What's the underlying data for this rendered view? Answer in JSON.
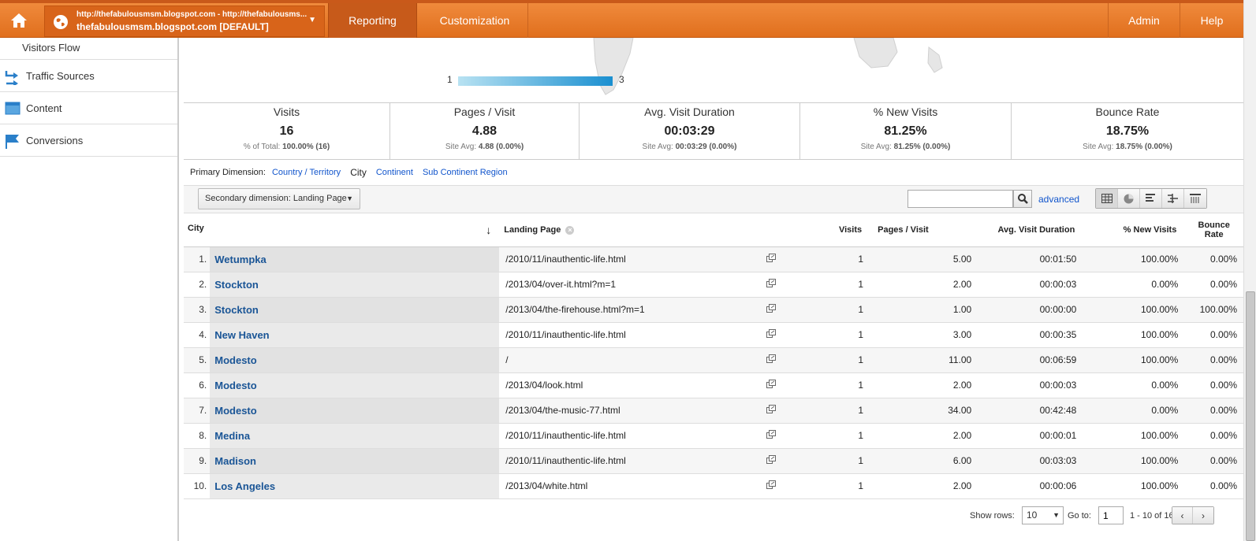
{
  "topbar": {
    "account_line1": "http://thefabulousmsm.blogspot.com - http://thefabulousms...",
    "account_line2": "thefabulousmsm.blogspot.com [DEFAULT]",
    "tabs": [
      "Reporting",
      "Customization"
    ],
    "right_tabs": [
      "Admin",
      "Help"
    ]
  },
  "sidebar": {
    "items": [
      "Visitors Flow",
      "Traffic Sources",
      "Content",
      "Conversions"
    ]
  },
  "legend": {
    "low": "1",
    "high": "3"
  },
  "summary": [
    {
      "title": "Visits",
      "value": "16",
      "sub_label": "% of Total:",
      "sub_value": "100.00% (16)"
    },
    {
      "title": "Pages / Visit",
      "value": "4.88",
      "sub_label": "Site Avg:",
      "sub_value": "4.88 (0.00%)"
    },
    {
      "title": "Avg. Visit Duration",
      "value": "00:03:29",
      "sub_label": "Site Avg:",
      "sub_value": "00:03:29 (0.00%)"
    },
    {
      "title": "% New Visits",
      "value": "81.25%",
      "sub_label": "Site Avg:",
      "sub_value": "81.25% (0.00%)"
    },
    {
      "title": "Bounce Rate",
      "value": "18.75%",
      "sub_label": "Site Avg:",
      "sub_value": "18.75% (0.00%)"
    }
  ],
  "dimensions": {
    "label": "Primary Dimension:",
    "options": [
      "Country / Territory",
      "City",
      "Continent",
      "Sub Continent Region"
    ],
    "selected": "City"
  },
  "toolbar": {
    "secondary_dimension": "Secondary dimension: Landing Page",
    "search_value": "",
    "advanced": "advanced"
  },
  "table": {
    "headers": [
      "City",
      "Landing Page",
      "Visits",
      "Pages / Visit",
      "Avg. Visit Duration",
      "% New Visits",
      "Bounce Rate"
    ],
    "rows": [
      {
        "idx": "1.",
        "city": "Wetumpka",
        "page": "/2010/11/inauthentic-life.html",
        "visits": "1",
        "ppv": "5.00",
        "dur": "00:01:50",
        "newv": "100.00%",
        "bounce": "0.00%"
      },
      {
        "idx": "2.",
        "city": "Stockton",
        "page": "/2013/04/over-it.html?m=1",
        "visits": "1",
        "ppv": "2.00",
        "dur": "00:00:03",
        "newv": "0.00%",
        "bounce": "0.00%"
      },
      {
        "idx": "3.",
        "city": "Stockton",
        "page": "/2013/04/the-firehouse.html?m=1",
        "visits": "1",
        "ppv": "1.00",
        "dur": "00:00:00",
        "newv": "100.00%",
        "bounce": "100.00%"
      },
      {
        "idx": "4.",
        "city": "New Haven",
        "page": "/2010/11/inauthentic-life.html",
        "visits": "1",
        "ppv": "3.00",
        "dur": "00:00:35",
        "newv": "100.00%",
        "bounce": "0.00%"
      },
      {
        "idx": "5.",
        "city": "Modesto",
        "page": "/",
        "visits": "1",
        "ppv": "11.00",
        "dur": "00:06:59",
        "newv": "100.00%",
        "bounce": "0.00%"
      },
      {
        "idx": "6.",
        "city": "Modesto",
        "page": "/2013/04/look.html",
        "visits": "1",
        "ppv": "2.00",
        "dur": "00:00:03",
        "newv": "0.00%",
        "bounce": "0.00%"
      },
      {
        "idx": "7.",
        "city": "Modesto",
        "page": "/2013/04/the-music-77.html",
        "visits": "1",
        "ppv": "34.00",
        "dur": "00:42:48",
        "newv": "0.00%",
        "bounce": "0.00%"
      },
      {
        "idx": "8.",
        "city": "Medina",
        "page": "/2010/11/inauthentic-life.html",
        "visits": "1",
        "ppv": "2.00",
        "dur": "00:00:01",
        "newv": "100.00%",
        "bounce": "0.00%"
      },
      {
        "idx": "9.",
        "city": "Madison",
        "page": "/2010/11/inauthentic-life.html",
        "visits": "1",
        "ppv": "6.00",
        "dur": "00:03:03",
        "newv": "100.00%",
        "bounce": "0.00%"
      },
      {
        "idx": "10.",
        "city": "Los Angeles",
        "page": "/2013/04/white.html",
        "visits": "1",
        "ppv": "2.00",
        "dur": "00:00:06",
        "newv": "100.00%",
        "bounce": "0.00%"
      }
    ]
  },
  "pager": {
    "show_rows_label": "Show rows:",
    "rows_value": "10",
    "goto_label": "Go to:",
    "goto_value": "1",
    "range": "1 - 10 of 16"
  }
}
